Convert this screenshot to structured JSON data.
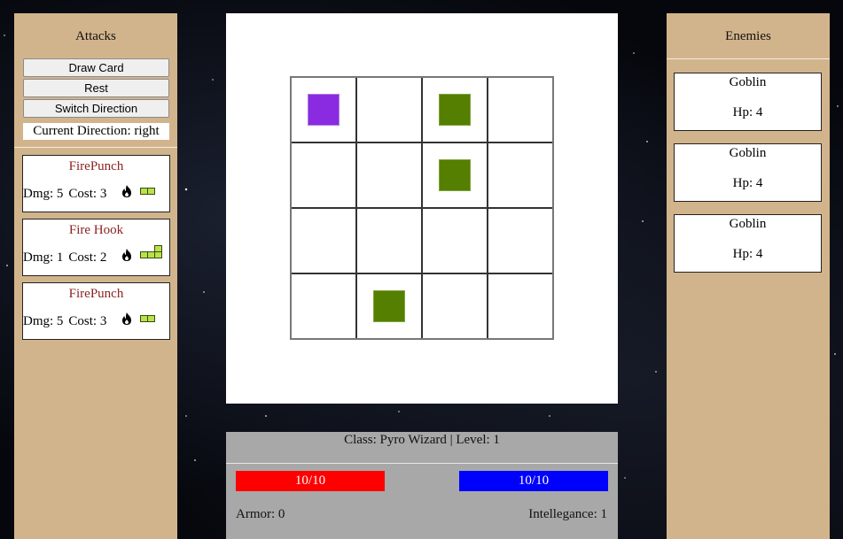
{
  "attacks_panel": {
    "title": "Attacks",
    "buttons": {
      "draw_card": "Draw Card",
      "rest": "Rest",
      "switch_direction": "Switch Direction"
    },
    "current_direction": "Current Direction: right",
    "cards": [
      {
        "name": "FirePunch",
        "dmg": "Dmg: 5",
        "cost": "Cost: 3",
        "element_icon": "fire-icon",
        "pattern": "two-horizontal"
      },
      {
        "name": "Fire Hook",
        "dmg": "Dmg: 1",
        "cost": "Cost: 2",
        "element_icon": "fire-icon",
        "pattern": "hook"
      },
      {
        "name": "FirePunch",
        "dmg": "Dmg: 5",
        "cost": "Cost: 3",
        "element_icon": "fire-icon",
        "pattern": "two-horizontal"
      }
    ]
  },
  "board": {
    "rows": 4,
    "cols": 4,
    "tokens": [
      {
        "type": "player",
        "row": 0,
        "col": 0,
        "color": "#8a2be2"
      },
      {
        "type": "enemy",
        "row": 0,
        "col": 2,
        "color": "#557f00"
      },
      {
        "type": "enemy",
        "row": 1,
        "col": 2,
        "color": "#557f00"
      },
      {
        "type": "enemy",
        "row": 3,
        "col": 1,
        "color": "#557f00"
      }
    ]
  },
  "status": {
    "class_level": "Class: Pyro Wizard | Level: 1",
    "health": {
      "text": "10/10",
      "current": 10,
      "max": 10,
      "color": "#ff0000"
    },
    "mana": {
      "text": "10/10",
      "current": 10,
      "max": 10,
      "color": "#0000ff"
    },
    "armor": "Armor: 0",
    "intelligence": "Intellegance: 1"
  },
  "enemies_panel": {
    "title": "Enemies",
    "enemies": [
      {
        "name": "Goblin",
        "hp": "Hp: 4"
      },
      {
        "name": "Goblin",
        "hp": "Hp: 4"
      },
      {
        "name": "Goblin",
        "hp": "Hp: 4"
      }
    ]
  },
  "colors": {
    "panel": "#d2b48c",
    "card_name": "#8b2323",
    "status_bg": "#a8a8a8",
    "pattern_square": "#b7e24a"
  }
}
